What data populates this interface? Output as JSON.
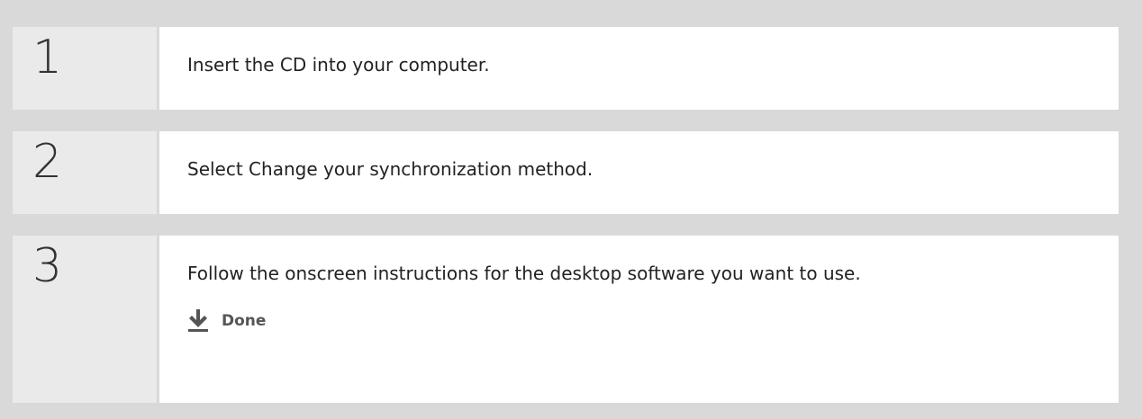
{
  "steps": [
    {
      "number": "1",
      "text": "Insert the CD into your computer."
    },
    {
      "number": "2",
      "text": "Select Change your synchronization method."
    },
    {
      "number": "3",
      "text": "Follow the onscreen instructions for the desktop software you want to use."
    }
  ],
  "done": {
    "label": "Done",
    "icon": "down-arrow-icon"
  }
}
